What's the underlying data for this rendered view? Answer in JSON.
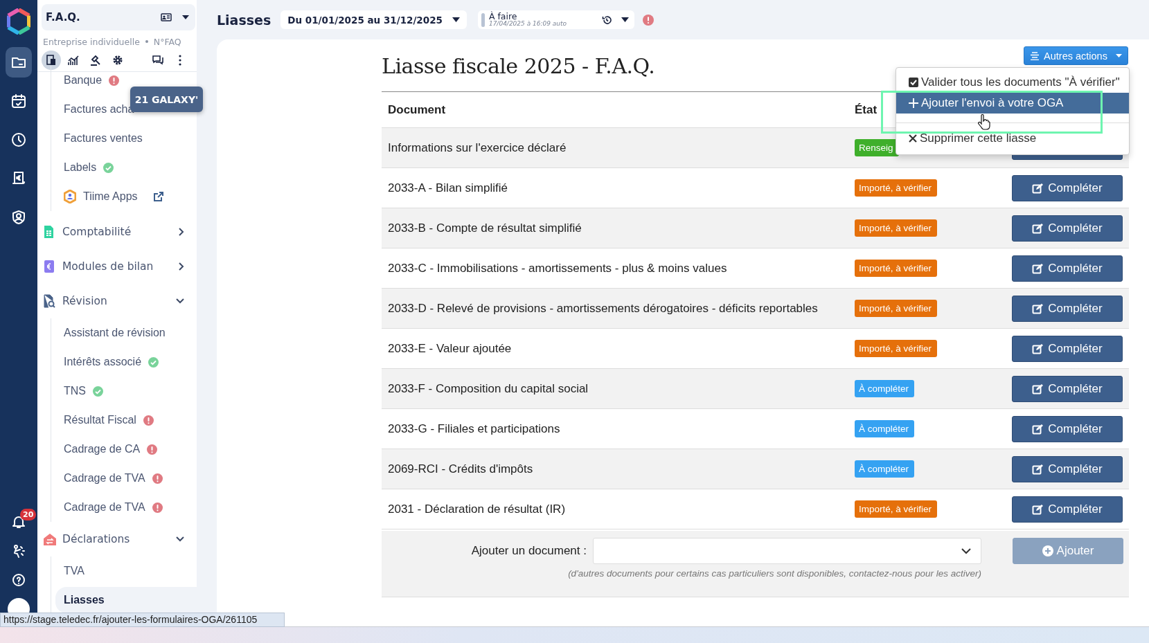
{
  "rail": {
    "items": [
      {
        "kind": "folder",
        "selected": true
      },
      {
        "kind": "calendar",
        "selected": false
      },
      {
        "kind": "clock",
        "selected": false
      },
      {
        "kind": "receipt",
        "selected": false
      },
      {
        "kind": "contact",
        "selected": false
      }
    ],
    "bottom": [
      {
        "kind": "bell",
        "badge": "20"
      },
      {
        "kind": "figure"
      },
      {
        "kind": "help"
      },
      {
        "kind": "avatar"
      }
    ]
  },
  "sidebar": {
    "company": "F.A.Q.",
    "subtitle": "Entreprise individuelle",
    "number": "N°FAQ",
    "tools": [
      {
        "kind": "docs",
        "selected": true
      },
      {
        "kind": "chart",
        "selected": false
      },
      {
        "kind": "gavel",
        "selected": false
      },
      {
        "kind": "gear",
        "selected": false
      },
      {
        "kind": "chat",
        "selected": false
      },
      {
        "kind": "more",
        "selected": false
      }
    ],
    "items": [
      {
        "label": "Banque",
        "kind": "error",
        "selected": false
      },
      {
        "label": "Factures acha",
        "selected": false
      },
      {
        "label": "Factures ventes",
        "selected": false
      },
      {
        "label": "Labels",
        "kind": "ok",
        "selected": false
      },
      {
        "label": "Tiime Apps",
        "kind": "app",
        "selected": false
      }
    ],
    "sections": [
      {
        "label": "Comptabilité",
        "kind": "accounting",
        "expanded": false
      },
      {
        "label": "Modules de bilan",
        "kind": "modules",
        "expanded": false
      },
      {
        "label": "Révision",
        "kind": "review",
        "expanded": true,
        "children": [
          {
            "label": "Assistant de révision",
            "selected": false
          },
          {
            "label": "Intérêts associé",
            "kind": "ok",
            "selected": false
          },
          {
            "label": "TNS",
            "kind": "ok",
            "selected": false
          },
          {
            "label": "Résultat Fiscal",
            "kind": "error",
            "selected": false
          },
          {
            "label": "Cadrage de CA",
            "kind": "error",
            "selected": false
          },
          {
            "label": "Cadrage de TVA",
            "kind": "error",
            "selected": false
          },
          {
            "label": "Cadrage de TVA",
            "kind": "error",
            "selected": false
          }
        ]
      },
      {
        "label": "Déclarations",
        "kind": "declarations",
        "expanded": true,
        "children": [
          {
            "label": "TVA",
            "selected": false
          },
          {
            "label": "Liasses",
            "selected": true
          }
        ]
      }
    ]
  },
  "tooltip": "21 GALAXY'",
  "topbar": {
    "title": "Liasses",
    "period": "Du 01/01/2025 au 31/12/2025",
    "status": "À faire",
    "status_time": "17/04/2025 à 16:09 auto",
    "alert": true
  },
  "content": {
    "title": "Liasse fiscale 2025 - F.A.Q.",
    "actions_button": "Autres actions",
    "menu": [
      {
        "kind": "check",
        "label": "Valider tous les documents \"À vérifier\"",
        "highlighted": false,
        "separated": false
      },
      {
        "kind": "add",
        "label": "Ajouter l'envoi à votre OGA",
        "highlighted": true,
        "separated": false
      },
      {
        "kind": "delete",
        "label": "Supprimer cette liasse",
        "highlighted": false,
        "separated": true
      }
    ],
    "columns": [
      "Document",
      "État"
    ],
    "rows": [
      {
        "document": "Informations sur l'exercice déclaré",
        "status": "Renseig",
        "kind": "done"
      },
      {
        "document": "2033-A - Bilan simplifié",
        "status": "Importé, à vérifier",
        "kind": "check",
        "action": "Compléter"
      },
      {
        "document": "2033-B - Compte de résultat simplifié",
        "status": "Importé, à vérifier",
        "kind": "check",
        "action": "Compléter"
      },
      {
        "document": "2033-C - Immobilisations - amortissements - plus & moins values",
        "status": "Importé, à vérifier",
        "kind": "check",
        "action": "Compléter"
      },
      {
        "document": "2033-D - Relevé de provisions - amortissements dérogatoires - déficits reportables",
        "status": "Importé, à vérifier",
        "kind": "check",
        "action": "Compléter"
      },
      {
        "document": "2033-E - Valeur ajoutée",
        "status": "Importé, à vérifier",
        "kind": "check",
        "action": "Compléter"
      },
      {
        "document": "2033-F - Composition du capital social",
        "status": "À compléter",
        "kind": "todo",
        "action": "Compléter"
      },
      {
        "document": "2033-G - Filiales et participations",
        "status": "À compléter",
        "kind": "todo",
        "action": "Compléter"
      },
      {
        "document": "2069-RCI - Crédits d'impôts",
        "status": "À compléter",
        "kind": "todo",
        "action": "Compléter"
      },
      {
        "document": "2031 - Déclaration de résultat (IR)",
        "status": "Importé, à vérifier",
        "kind": "check",
        "action": "Compléter"
      }
    ],
    "add_document": {
      "label": "Ajouter un document :",
      "hint": "(d'autres documents pour certains cas particuliers sont disponibles, contactez-nous pour les activer)",
      "button": "Ajouter",
      "disabled": true
    }
  },
  "status_url": "https://stage.teledec.fr/ajouter-les-formulaires-OGA/261105"
}
